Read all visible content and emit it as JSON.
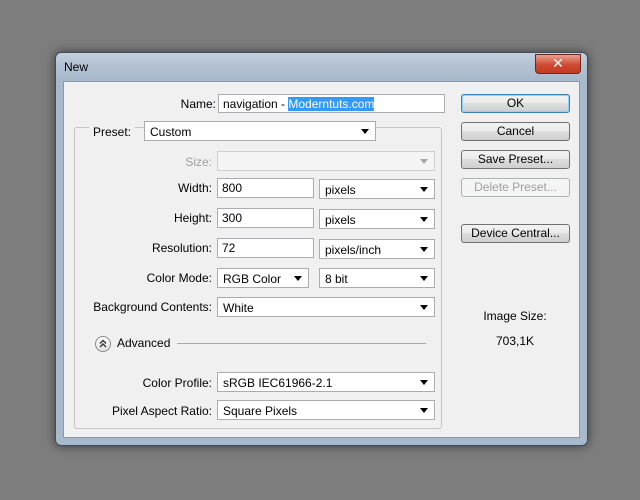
{
  "window": {
    "title": "New",
    "close_glyph": "✕"
  },
  "name": {
    "label": "Name:",
    "value_plain": "navigation - ",
    "value_selected": "Moderntuts.com"
  },
  "preset": {
    "label": "Preset:",
    "value": "Custom"
  },
  "size": {
    "label": "Size:",
    "value": ""
  },
  "width": {
    "label": "Width:",
    "value": "800",
    "unit": "pixels"
  },
  "height": {
    "label": "Height:",
    "value": "300",
    "unit": "pixels"
  },
  "resolution": {
    "label": "Resolution:",
    "value": "72",
    "unit": "pixels/inch"
  },
  "color_mode": {
    "label": "Color Mode:",
    "mode": "RGB Color",
    "depth": "8 bit"
  },
  "background": {
    "label": "Background Contents:",
    "value": "White"
  },
  "advanced": {
    "label": "Advanced",
    "icon": "double-chevron-up-icon"
  },
  "color_profile": {
    "label": "Color Profile:",
    "value": "sRGB IEC61966-2.1"
  },
  "pixel_aspect": {
    "label": "Pixel Aspect Ratio:",
    "value": "Square Pixels"
  },
  "buttons": {
    "ok": "OK",
    "cancel": "Cancel",
    "save_preset": "Save Preset...",
    "delete_preset": "Delete Preset...",
    "device_central": "Device Central..."
  },
  "image_size": {
    "label": "Image Size:",
    "value": "703,1K"
  },
  "colors": {
    "selection": "#3399ff",
    "desktop": "#7d7d7d",
    "close_button": "#cf4a32"
  }
}
